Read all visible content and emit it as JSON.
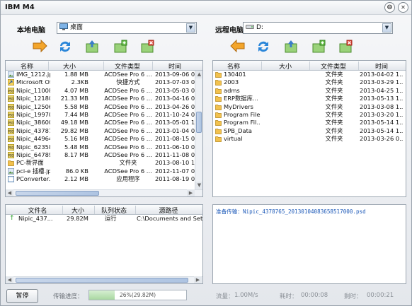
{
  "window": {
    "title": "IBM M4",
    "minimize_symbol": "⊖",
    "close_symbol": "✕"
  },
  "local": {
    "label": "本地电脑",
    "location": "桌面",
    "columns": [
      "名称",
      "大小",
      "文件类型",
      "时间"
    ],
    "files": [
      {
        "name": "IMG_1212.jpg",
        "size": "1.88 MB",
        "type": "ACDSee Pro 6 ...",
        "time": "2013-09-06 03.",
        "icon": "image"
      },
      {
        "name": "Microsoft Of...",
        "size": "2.3KB",
        "type": "快捷方式",
        "time": "2013-07-03 02.",
        "icon": "shortcut"
      },
      {
        "name": "Nipic_11008...",
        "size": "4.07 MB",
        "type": "ACDSee Pro 6 ...",
        "time": "2013-05-03 08.",
        "icon": "psd"
      },
      {
        "name": "Nipic_12180...",
        "size": "21.33 MB",
        "type": "ACDSee Pro 6 ...",
        "time": "2013-04-16 05.",
        "icon": "psd"
      },
      {
        "name": "Nipic_12506...",
        "size": "5.58 MB",
        "type": "ACDSee Pro 6 ...",
        "time": "2013-04-26 06.",
        "icon": "psd"
      },
      {
        "name": "Nipic_19970...",
        "size": "7.44 MB",
        "type": "ACDSee Pro 6 ...",
        "time": "2011-10-24 07.",
        "icon": "psd"
      },
      {
        "name": "Nipic_38600...",
        "size": "49.18 MB",
        "type": "ACDSee Pro 6 ...",
        "time": "2013-05-01 14.",
        "icon": "psd"
      },
      {
        "name": "Nipic_43787...",
        "size": "29.82 MB",
        "type": "ACDSee Pro 6 ...",
        "time": "2013-01-04 00.",
        "icon": "psd"
      },
      {
        "name": "Nipic_44964...",
        "size": "5.16 MB",
        "type": "ACDSee Pro 6 ...",
        "time": "2011-08-15 02.",
        "icon": "psd"
      },
      {
        "name": "Nipic_62358...",
        "size": "5.48 MB",
        "type": "ACDSee Pro 6 ...",
        "time": "2011-06-10 00.",
        "icon": "psd"
      },
      {
        "name": "Nipic_64789...",
        "size": "8.17 MB",
        "type": "ACDSee Pro 6 ...",
        "time": "2011-11-08 02.",
        "icon": "psd"
      },
      {
        "name": "PC-新界面",
        "size": "",
        "type": "文件夹",
        "time": "2013-08-10 10.",
        "icon": "folder"
      },
      {
        "name": "pci-e 插槽.jpg",
        "size": "86.0 KB",
        "type": "ACDSee Pro 6 ...",
        "time": "2012-11-07 00.",
        "icon": "image"
      },
      {
        "name": "PConverter...",
        "size": "2.12 MB",
        "type": "应用程序",
        "time": "2011-08-19 02.",
        "icon": "app"
      }
    ]
  },
  "remote": {
    "label": "远程电脑",
    "location": "D:",
    "columns": [
      "名称",
      "大小",
      "文件类型",
      "时间"
    ],
    "files": [
      {
        "name": "130401",
        "size": "",
        "type": "文件夹",
        "time": "2013-04-02 1...",
        "icon": "folder"
      },
      {
        "name": "2003",
        "size": "",
        "type": "文件夹",
        "time": "2013-03-29 1...",
        "icon": "folder"
      },
      {
        "name": "adms",
        "size": "",
        "type": "文件夹",
        "time": "2013-04-25 1...",
        "icon": "folder"
      },
      {
        "name": "ERP数据库...",
        "size": "",
        "type": "文件夹",
        "time": "2013-05-13 1...",
        "icon": "folder"
      },
      {
        "name": "MyDrivers",
        "size": "",
        "type": "文件夹",
        "time": "2013-03-08 1...",
        "icon": "folder"
      },
      {
        "name": "Program Files",
        "size": "",
        "type": "文件夹",
        "time": "2013-03-20 1...",
        "icon": "folder"
      },
      {
        "name": "Program Fil...",
        "size": "",
        "type": "文件夹",
        "time": "2013-05-14 1...",
        "icon": "folder"
      },
      {
        "name": "SPB_Data",
        "size": "",
        "type": "文件夹",
        "time": "2013-05-14 1...",
        "icon": "folder"
      },
      {
        "name": "virtual",
        "size": "",
        "type": "文件夹",
        "time": "2013-03-26 0...",
        "icon": "folder"
      }
    ]
  },
  "transfer": {
    "columns": [
      "文件名",
      "大小",
      "队列状态",
      "源路径"
    ],
    "rows": [
      {
        "name": "Nipic_437...",
        "size": "29.82M",
        "status": "运行",
        "path": "C:\\Documents and Settings\\s"
      }
    ]
  },
  "log": {
    "line": "准备传输：Nipic_4378765_20130104083658517000.psd"
  },
  "status": {
    "pause_button": "暂停",
    "progress_label": "传输进度：",
    "progress_text": "26%(29.82M)",
    "progress_fraction": 0.26,
    "rate_label": "流量：",
    "rate_value": "1.00M/s",
    "elapsed_label": "耗时：",
    "elapsed_value": "00:00:08",
    "remaining_label": "剩时：",
    "remaining_value": "00:00:21"
  },
  "colors": {
    "accent_blue": "#1b58b8",
    "folder": "#f2c14e",
    "psd_badge": "#c9a400"
  }
}
